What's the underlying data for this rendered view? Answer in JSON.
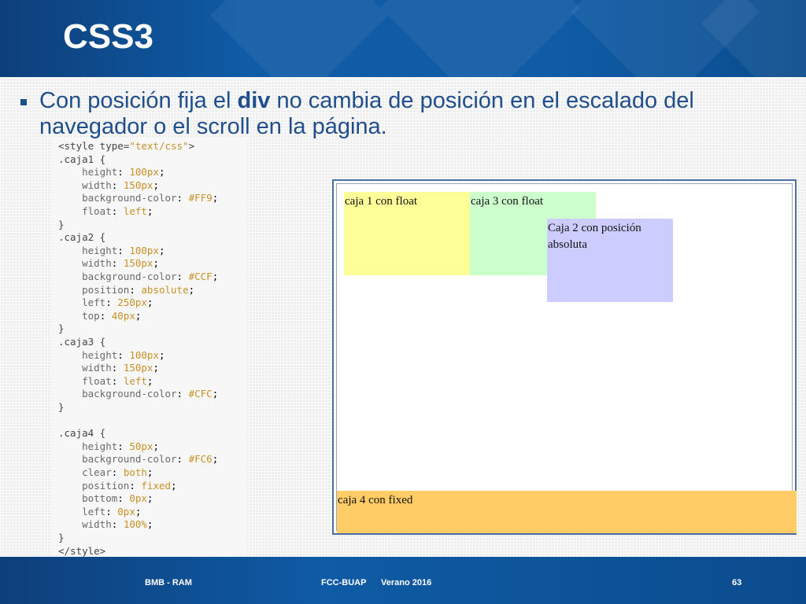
{
  "slide": {
    "title": "CSS3",
    "bullet": {
      "text_before": "Con posición fija el ",
      "bold": "div",
      "text_after": " no cambia de posición en el escalado del navegador o el scroll en la página."
    }
  },
  "code": {
    "lines": [
      {
        "text": "<style type=\"text/css\">",
        "kind": "sel"
      },
      {
        "text": ".caja1 {",
        "kind": "sel"
      },
      {
        "prop": "height",
        "value": "100px"
      },
      {
        "prop": "width",
        "value": "150px"
      },
      {
        "prop": "background-color",
        "value": "#FF9"
      },
      {
        "prop": "float",
        "value": "left"
      },
      {
        "text": "}",
        "kind": "brace"
      },
      {
        "text": ".caja2 {",
        "kind": "sel"
      },
      {
        "prop": "height",
        "value": "100px"
      },
      {
        "prop": "width",
        "value": "150px"
      },
      {
        "prop": "background-color",
        "value": "#CCF"
      },
      {
        "prop": "position",
        "value": "absolute"
      },
      {
        "prop": "left",
        "value": "250px"
      },
      {
        "prop": "top",
        "value": "40px"
      },
      {
        "text": "}",
        "kind": "brace"
      },
      {
        "text": ".caja3 {",
        "kind": "sel"
      },
      {
        "prop": "height",
        "value": "100px"
      },
      {
        "prop": "width",
        "value": "150px"
      },
      {
        "prop": "float",
        "value": "left"
      },
      {
        "prop": "background-color",
        "value": "#CFC"
      },
      {
        "text": "}",
        "kind": "brace"
      },
      {
        "text": "",
        "kind": "blank"
      },
      {
        "text": ".caja4 {",
        "kind": "sel"
      },
      {
        "prop": "height",
        "value": "50px"
      },
      {
        "prop": "background-color",
        "value": "#FC6"
      },
      {
        "prop": "clear",
        "value": "both"
      },
      {
        "prop": "position",
        "value": "fixed"
      },
      {
        "prop": "bottom",
        "value": "0px"
      },
      {
        "prop": "left",
        "value": "0px"
      },
      {
        "prop": "width",
        "value": "100%"
      },
      {
        "text": "}",
        "kind": "brace"
      },
      {
        "text": "</style>",
        "kind": "sel"
      }
    ]
  },
  "demo": {
    "caja1": "caja 1 con float",
    "caja3": "caja 3 con float",
    "caja2": "Caja 2 con posición absoluta",
    "caja4": "caja 4 con fixed"
  },
  "footer": {
    "left": "BMB - RAM",
    "center": "FCC-BUAP",
    "term": "Verano 2016",
    "page": "63"
  },
  "colors": {
    "header": "#0f5ba5",
    "text": "#1f4e8c",
    "caja1": "#ffff99",
    "caja2": "#ccccff",
    "caja3": "#ccffcc",
    "caja4": "#ffcc66"
  }
}
